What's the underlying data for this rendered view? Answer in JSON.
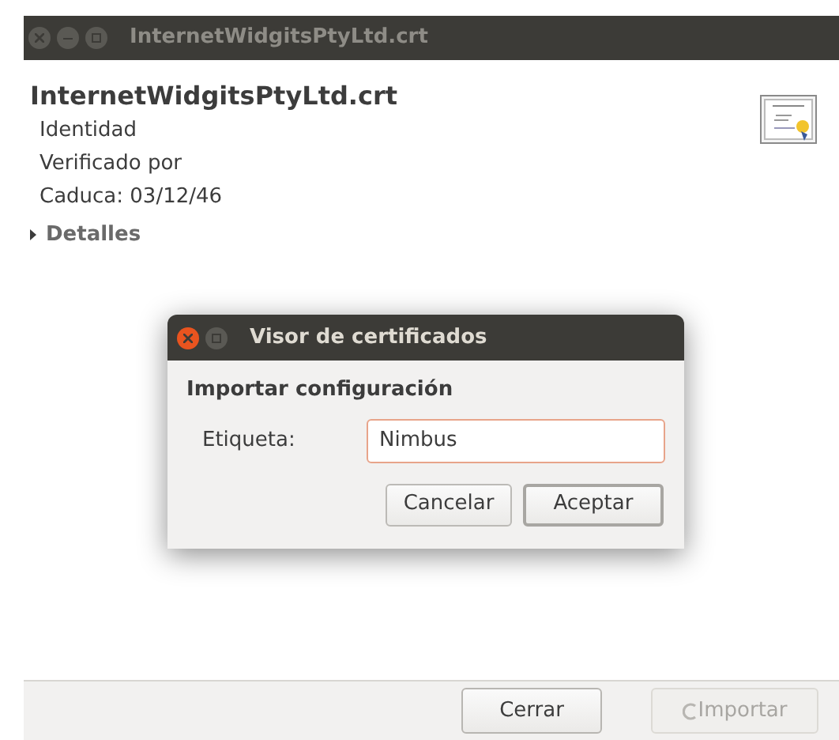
{
  "window": {
    "title": "InternetWidgitsPtyLtd.crt",
    "active": false
  },
  "certificate": {
    "name": "InternetWidgitsPtyLtd.crt",
    "lines": [
      "Identidad",
      "Verificado por",
      "Caduca: 03/12/46"
    ]
  },
  "details": {
    "label": "Detalles",
    "expanded": false
  },
  "footer_buttons": [
    {
      "label": "Cerrar",
      "disabled": false,
      "busy": false
    },
    {
      "label": "Importar",
      "disabled": true,
      "busy": true
    }
  ],
  "dialog": {
    "title": "Visor de certificados",
    "active": true,
    "heading": "Importar configuración",
    "field": {
      "label": "Etiqueta:",
      "value": "Nimbus",
      "focused": true
    },
    "buttons": [
      {
        "label": "Cancelar",
        "default": false
      },
      {
        "label": "Aceptar",
        "default": true
      }
    ]
  }
}
